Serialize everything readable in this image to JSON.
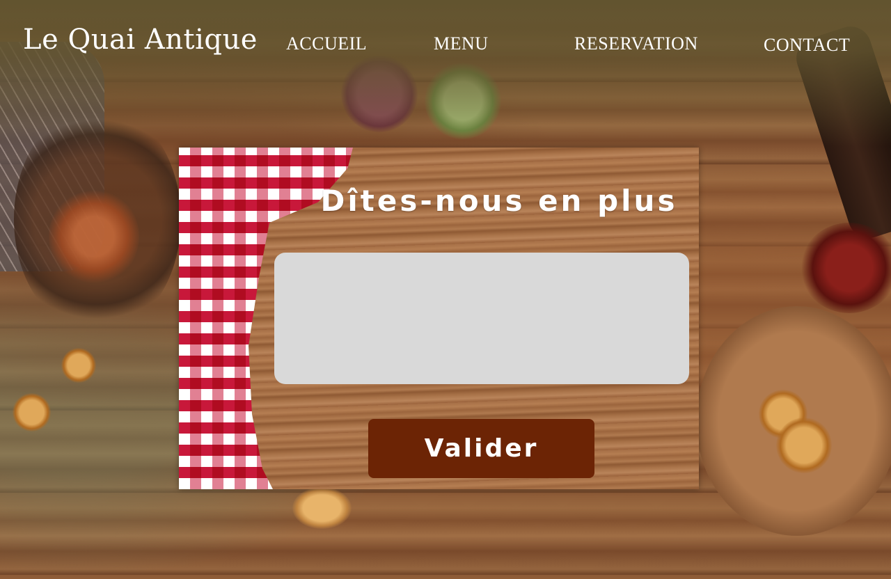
{
  "brand": {
    "name": "Le Quai Antique"
  },
  "nav": {
    "items": [
      {
        "label": "ACCUEIL"
      },
      {
        "label": "MENU"
      },
      {
        "label": "RESERVATION"
      },
      {
        "label": "CONTACT"
      }
    ]
  },
  "form": {
    "title": "Dîtes-nous en plus",
    "message_value": "",
    "message_placeholder": "",
    "submit_label": "Valider"
  },
  "colors": {
    "header_overlay": "#62542f",
    "textarea_bg": "#d9d9d9",
    "button_bg": "#6c2405",
    "text": "#ffffff"
  }
}
